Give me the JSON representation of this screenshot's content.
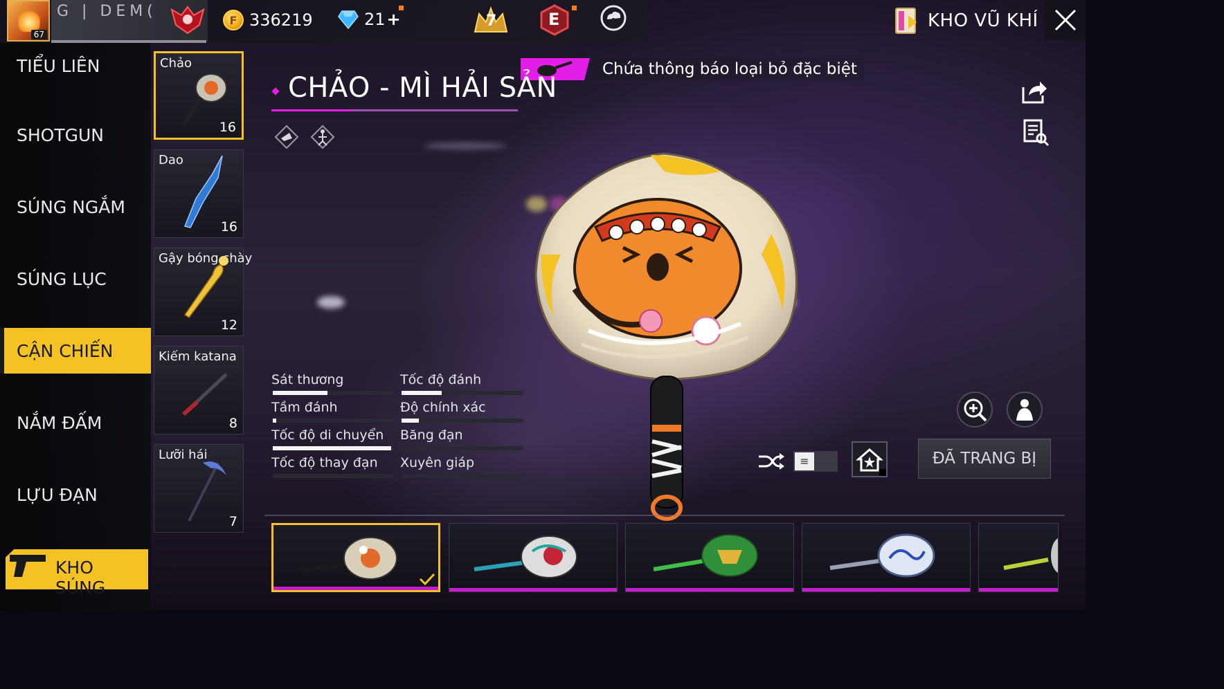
{
  "topbar": {
    "level": "67",
    "guild_name": "G | DEM(",
    "gold": "336219",
    "diamonds": "21",
    "diamonds_add": "+",
    "rank_number": "7",
    "elite_letter": "E",
    "arsenal_label": "KHO VŨ KHÍ"
  },
  "categories": [
    {
      "label": "TIỂU LIÊN",
      "active": false
    },
    {
      "label": "SHOTGUN",
      "active": false
    },
    {
      "label": "SÚNG NGẮM",
      "active": false
    },
    {
      "label": "SÚNG LỤC",
      "active": false
    },
    {
      "label": "CẬN CHIẾN",
      "active": true
    },
    {
      "label": "NẮM ĐẤM",
      "active": false
    },
    {
      "label": "LỰU ĐẠN",
      "active": false
    }
  ],
  "kho_sung_label": "KHO SÚNG",
  "weapons": [
    {
      "name": "Chảo",
      "count": "16",
      "selected": true
    },
    {
      "name": "Dao",
      "count": "16",
      "selected": false
    },
    {
      "name": "Gậy bóng chày",
      "count": "12",
      "selected": false
    },
    {
      "name": "Kiếm katana",
      "count": "8",
      "selected": false
    },
    {
      "name": "Lưỡi hái",
      "count": "7",
      "selected": false
    }
  ],
  "item": {
    "notice": "Chứa thông báo loại bỏ đặc biệt",
    "title": "CHẢO - MÌ HẢI SẢN"
  },
  "stats": [
    {
      "label": "Sát thương",
      "value": 0.45
    },
    {
      "label": "Tốc độ đánh",
      "value": 0.33
    },
    {
      "label": "Tầm đánh",
      "value": 0.03
    },
    {
      "label": "Độ chính xác",
      "value": 0.14
    },
    {
      "label": "Tốc độ di chuyển",
      "value": 0.97
    },
    {
      "label": "Băng đạn",
      "value": 0.0
    },
    {
      "label": "Tốc độ thay đạn",
      "value": 0.0
    },
    {
      "label": "Xuyên giáp",
      "value": 0.0
    }
  ],
  "controls": {
    "toggle_glyph": "≡",
    "equip_label": "ĐÃ TRANG BỊ"
  },
  "skins": [
    {
      "theme": "seafood-noodle",
      "selected": true
    },
    {
      "theme": "graffiti-teal",
      "selected": false
    },
    {
      "theme": "green-gold",
      "selected": false
    },
    {
      "theme": "blue-dragon",
      "selected": false
    },
    {
      "theme": "partial",
      "selected": false
    }
  ],
  "colors": {
    "accent_yellow": "#f5c225",
    "accent_magenta": "#e21ee8",
    "rarity_purple": "#c51cd0"
  }
}
